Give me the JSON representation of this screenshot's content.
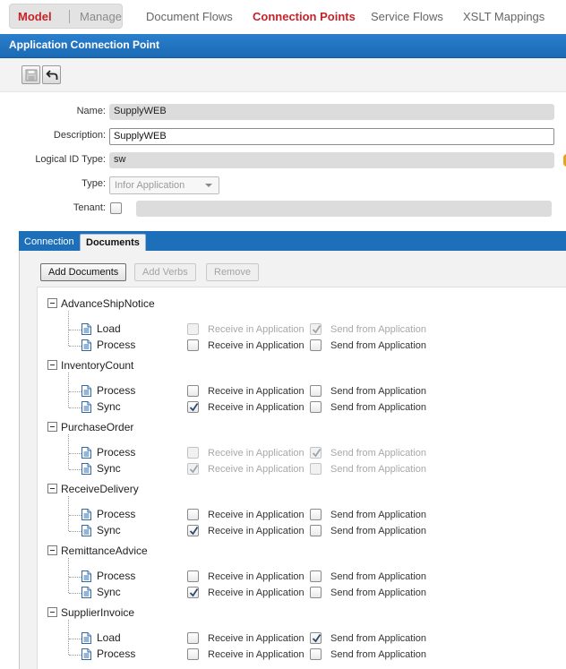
{
  "nav": {
    "model_label": "Model",
    "manage_label": "Manage",
    "links": [
      "Document Flows",
      "Connection Points",
      "Service Flows",
      "XSLT Mappings"
    ],
    "active_link": "Connection Points"
  },
  "title": "Application Connection Point",
  "toolbar": {
    "save_icon": "save-icon",
    "undo_icon": "undo-icon"
  },
  "form": {
    "name_label": "Name:",
    "name_value": "SupplyWEB",
    "description_label": "Description:",
    "description_value": "SupplyWEB",
    "logical_id_label": "Logical ID Type:",
    "logical_id_value": "sw",
    "type_label": "Type:",
    "type_value": "Infor Application",
    "tenant_label": "Tenant:"
  },
  "tabs": [
    {
      "label": "Connection",
      "active": false
    },
    {
      "label": "Documents",
      "active": true
    }
  ],
  "buttons": {
    "add_documents": "Add Documents",
    "add_verbs": "Add Verbs",
    "remove": "Remove"
  },
  "checkbox_labels": {
    "receive": "Receive in Application",
    "send": "Send from Application"
  },
  "documents": [
    {
      "name": "AdvanceShipNotice",
      "verbs": [
        {
          "verb": "Load",
          "receive": false,
          "receive_enabled": false,
          "send": true,
          "send_enabled": false
        },
        {
          "verb": "Process",
          "receive": false,
          "receive_enabled": true,
          "send": false,
          "send_enabled": true
        }
      ]
    },
    {
      "name": "InventoryCount",
      "verbs": [
        {
          "verb": "Process",
          "receive": false,
          "receive_enabled": true,
          "send": false,
          "send_enabled": true
        },
        {
          "verb": "Sync",
          "receive": true,
          "receive_enabled": true,
          "send": false,
          "send_enabled": true
        }
      ]
    },
    {
      "name": "PurchaseOrder",
      "verbs": [
        {
          "verb": "Process",
          "receive": false,
          "receive_enabled": false,
          "send": true,
          "send_enabled": false
        },
        {
          "verb": "Sync",
          "receive": true,
          "receive_enabled": false,
          "send": false,
          "send_enabled": false
        }
      ]
    },
    {
      "name": "ReceiveDelivery",
      "verbs": [
        {
          "verb": "Process",
          "receive": false,
          "receive_enabled": true,
          "send": false,
          "send_enabled": true
        },
        {
          "verb": "Sync",
          "receive": true,
          "receive_enabled": true,
          "send": false,
          "send_enabled": true
        }
      ]
    },
    {
      "name": "RemittanceAdvice",
      "verbs": [
        {
          "verb": "Process",
          "receive": false,
          "receive_enabled": true,
          "send": false,
          "send_enabled": true
        },
        {
          "verb": "Sync",
          "receive": true,
          "receive_enabled": true,
          "send": false,
          "send_enabled": true
        }
      ]
    },
    {
      "name": "SupplierInvoice",
      "verbs": [
        {
          "verb": "Load",
          "receive": false,
          "receive_enabled": true,
          "send": true,
          "send_enabled": true
        },
        {
          "verb": "Process",
          "receive": false,
          "receive_enabled": true,
          "send": false,
          "send_enabled": true
        }
      ]
    }
  ]
}
